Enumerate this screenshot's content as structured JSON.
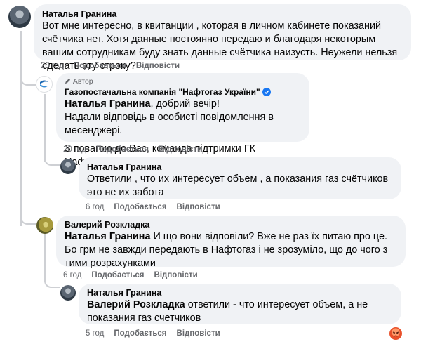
{
  "actions": {
    "like": "Подобається",
    "reply": "Відповісти"
  },
  "author_tag": "Автор",
  "comments": [
    {
      "author": "Наталья Гранина",
      "text": "Вот мне интересно, в квитанции , которая в личном кабинете показаний счётчика нет. Хотя данные постоянно передаю и благодаря некоторым вашим сотрудникам буду знать данные счётчика наизусть. Неужели нельзя сделать эту строку?",
      "time": "20 год"
    },
    {
      "author": "Газопостачальна компанія \"Нафтогаз України\"",
      "mention": "Наталья Гранина",
      "line1_rest": ", добрий вечір!",
      "line2": "Надали відповідь в особисті повідомлення в месенджері.",
      "line3": "З повагою до Вас, команда підтримки ГК Нафтогаз!",
      "time": "20 год"
    },
    {
      "author": "Наталья Гранина",
      "text": "Ответили , что их интересует объем , а показания газ счётчиков это не их забота",
      "time": "6 год"
    },
    {
      "author": "Валерий Розкладка",
      "mention": "Наталья Гранина",
      "text_rest": " И що вони відповіли? Вже не раз їх питаю про це. Бо грм не завжди передають в Нафтогаз і не зрозуміло, що до чого з тими розрахунками",
      "time": "6 год"
    },
    {
      "author": "Наталья Гранина",
      "mention": "Валерий Розкладка",
      "text_rest": " ответили - что интересует объем, а не показания газ счетчиков",
      "time": "5 год"
    }
  ],
  "reaction_icon": "angry-reaction-icon"
}
